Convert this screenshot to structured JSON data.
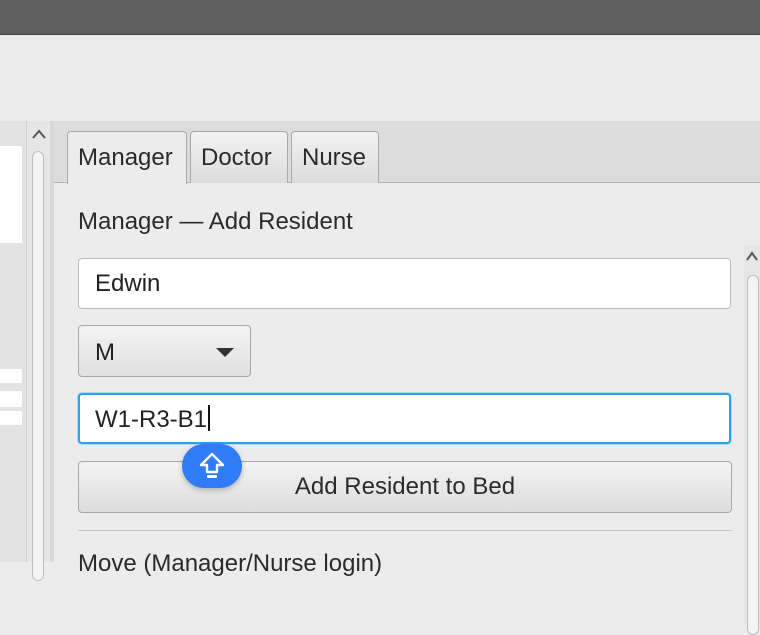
{
  "tabs": [
    {
      "label": "Manager",
      "selected": true
    },
    {
      "label": "Doctor",
      "selected": false
    },
    {
      "label": "Nurse",
      "selected": false
    }
  ],
  "manager_form": {
    "title": "Manager — Add Resident",
    "name_value": "Edwin",
    "gender_value": "M",
    "bed_value": "W1-R3-B1",
    "submit_label": "Add Resident to Bed",
    "next_section_title": "Move (Manager/Nurse login)"
  },
  "icons": {
    "keyboard_bubble": "shift-arrow-icon",
    "dropdown": "chevron-down-icon",
    "scroll_up": "scroll-up-arrow-icon"
  },
  "colors": {
    "focus_border": "#2aa4e4",
    "keyboard_bubble": "#2f7cf6",
    "title_bar": "#5f5f5f"
  }
}
